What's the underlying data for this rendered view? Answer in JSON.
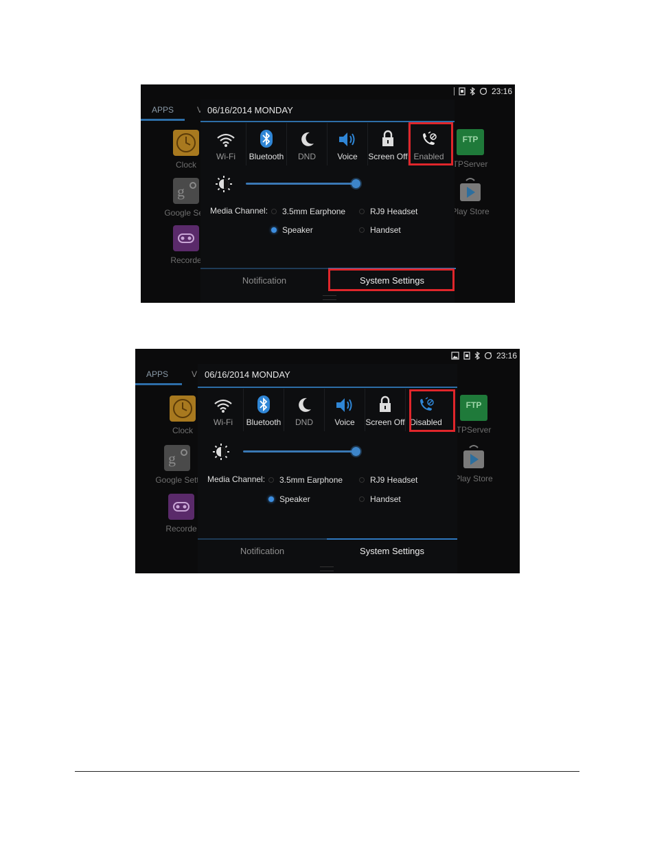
{
  "shots": [
    {
      "status": {
        "time": "23:16"
      },
      "apps_tab": {
        "label": "APPS",
        "extra": "V"
      },
      "date": "06/16/2014 MONDAY",
      "launcher_left": [
        {
          "name": "Clock",
          "icon": "clock-icon"
        },
        {
          "name": "Google Sett",
          "icon": "google-settings-icon"
        },
        {
          "name": "Recorde",
          "icon": "recorder-icon"
        }
      ],
      "launcher_right": [
        {
          "name": "TPServer",
          "icon": "ftp-server-icon"
        },
        {
          "name": "Play Store",
          "icon": "play-store-icon"
        }
      ],
      "tiles": [
        {
          "label": "Wi-Fi",
          "icon": "wifi-icon"
        },
        {
          "label": "Bluetooth",
          "icon": "bluetooth-icon"
        },
        {
          "label": "DND",
          "icon": "moon-icon"
        },
        {
          "label": "Voice",
          "icon": "speaker-icon"
        },
        {
          "label": "Screen Off",
          "icon": "lock-icon"
        },
        {
          "label": "Enabled",
          "icon": "call-forward-icon"
        }
      ],
      "media_channel": {
        "label": "Media Channel:",
        "options": [
          "3.5mm Earphone",
          "RJ9 Headset",
          "Speaker",
          "Handset"
        ],
        "selected": "Speaker"
      },
      "brightness": 0.98,
      "bottom_tabs": [
        "Notification",
        "System Settings"
      ],
      "selected_tab": "System Settings"
    },
    {
      "status": {
        "time": "23:16"
      },
      "apps_tab": {
        "label": "APPS",
        "extra": "V"
      },
      "date": "06/16/2014 MONDAY",
      "launcher_left": [
        {
          "name": "Clock",
          "icon": "clock-icon"
        },
        {
          "name": "Google Sett",
          "icon": "google-settings-icon"
        },
        {
          "name": "Recorde",
          "icon": "recorder-icon"
        }
      ],
      "launcher_right": [
        {
          "name": "TPServer",
          "icon": "ftp-server-icon"
        },
        {
          "name": "Play Store",
          "icon": "play-store-icon"
        }
      ],
      "tiles": [
        {
          "label": "Wi-Fi",
          "icon": "wifi-icon"
        },
        {
          "label": "Bluetooth",
          "icon": "bluetooth-icon"
        },
        {
          "label": "DND",
          "icon": "moon-icon"
        },
        {
          "label": "Voice",
          "icon": "speaker-icon"
        },
        {
          "label": "Screen Off",
          "icon": "lock-icon"
        },
        {
          "label": "Disabled",
          "icon": "call-forward-icon"
        }
      ],
      "media_channel": {
        "label": "Media Channel:",
        "options": [
          "3.5mm Earphone",
          "RJ9 Headset",
          "Speaker",
          "Handset"
        ],
        "selected": "Speaker"
      },
      "brightness": 0.98,
      "bottom_tabs": [
        "Notification",
        "System Settings"
      ],
      "selected_tab": "System Settings"
    }
  ],
  "colors": {
    "accent": "#2f78c0",
    "highlight": "#e0262b",
    "background": "#0b0b0c"
  }
}
